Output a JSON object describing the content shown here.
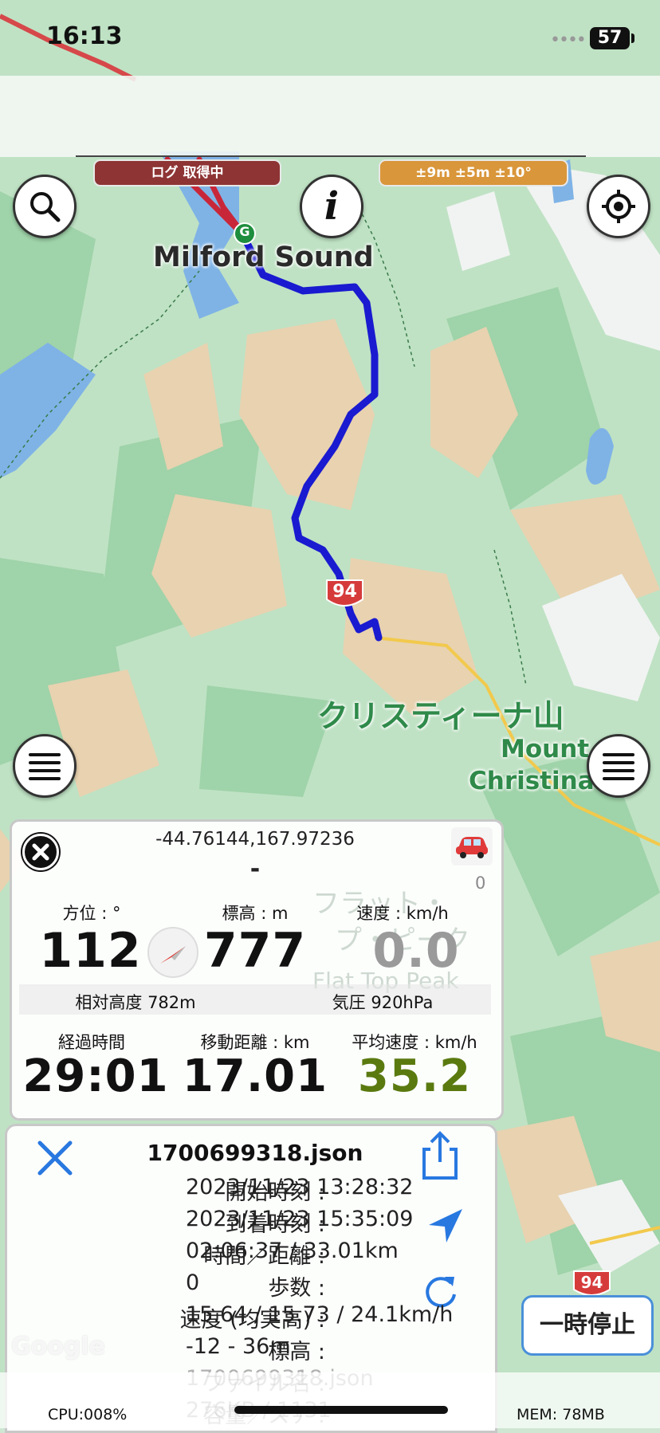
{
  "status_bar": {
    "time": "16:13",
    "battery": "57"
  },
  "overlay_pills": {
    "logging": "ログ 取得中",
    "accuracy": "±9m ±5m ±10°"
  },
  "colors": {
    "logging_pill": "#8e3434",
    "accuracy_pill": "#d9963a",
    "route": "#1a1ad0",
    "avg_speed": "#5a7a10"
  },
  "map": {
    "place_labels": {
      "milford": "Milford Sound",
      "christina_jp": "クリスティーナ山",
      "christina_en_1": "Mount",
      "christina_en_2": "Christina",
      "flat_top_1": "フラット・",
      "flat_top_2": "プ・ピーク",
      "flat_top_en": "Flat Top Peak"
    },
    "road_shields": {
      "top": "94",
      "bottom": "94"
    },
    "marker_letter": "G",
    "watermark": "Google"
  },
  "icons": {
    "search": "search-icon",
    "info": "info-icon",
    "locate": "locate-icon",
    "menu": "menu-icon",
    "close": "close-icon",
    "car": "car-icon",
    "compass": "compass-icon",
    "share": "share-icon",
    "navigate": "navigate-arrow-icon",
    "refresh": "refresh-icon"
  },
  "info_panel": {
    "coords": "-44.76144,167.97236",
    "address": "-",
    "car_count": "0",
    "heading_label": "方位 : °",
    "heading_value": "112",
    "altitude_label": "標高 : m",
    "altitude_value": "777",
    "speed_label": "速度 : km/h",
    "speed_value": "0.0",
    "relative_alt": "相対高度 782m",
    "pressure": "気圧 920hPa",
    "elapsed_label": "経過時間",
    "elapsed_value": "29:01",
    "distance_label": "移動距離 : km",
    "distance_value": "17.01",
    "avg_speed_label": "平均速度 : km/h",
    "avg_speed_value": "35.2"
  },
  "file_panel": {
    "filename": "1700699318.json",
    "rows": [
      {
        "key": "開始時刻 :",
        "value": "2023/11/23 13:28:32"
      },
      {
        "key": "到着時刻 :",
        "value": "2023/11/23 15:35:09"
      },
      {
        "key": "時間／距離 :",
        "value": "02:06:37 / 33.01km"
      },
      {
        "key": "歩数 :",
        "value": "0"
      },
      {
        "key": "速度 (均実高) :",
        "value": "15.64 / 15.73 / 24.1km/h"
      },
      {
        "key": "標高 :",
        "value": "-12 - 36m"
      },
      {
        "key": "ファイル名 :",
        "value": "1700699318.json"
      },
      {
        "key": "容量／ステ :",
        "value": "276KB / 1131"
      }
    ]
  },
  "pause_button": "一時停止",
  "footer": {
    "cpu": "CPU:008%",
    "mem": "MEM: 78MB"
  }
}
